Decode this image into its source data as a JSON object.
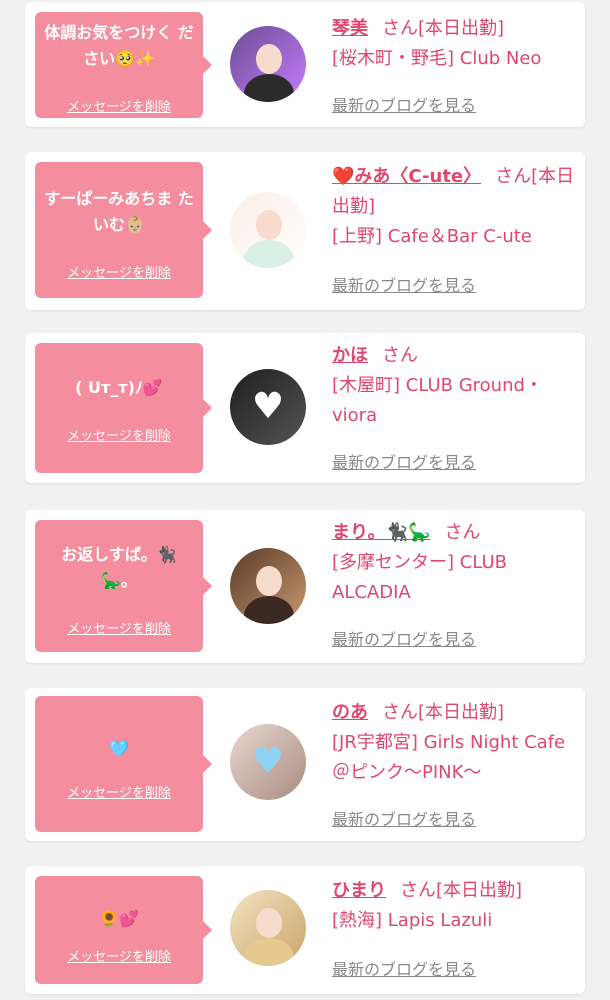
{
  "delete_label": "メッセージを削除",
  "blog_label": "最新のブログを見る",
  "cards": [
    {
      "msg": "体調お気をつけく ださい🥺✨",
      "name": "琴美",
      "san": "さん[本日出勤]",
      "store": "[桜木町・野毛] Club Neo"
    },
    {
      "msg": "すーぱーみあちま たいむ👶🏼",
      "name": "❤️みあ〈C-ute〉",
      "san": "さん[本日出勤]",
      "store": "[上野] Cafe＆Bar C-ute"
    },
    {
      "msg": "( Uт_т)ﾉ💕",
      "name": "かほ",
      "san": "さん",
      "store": "[木屋町] CLUB Ground・viora"
    },
    {
      "msg": "お返しすぱ。🐈‍⬛ 🦕。",
      "name": "まり。🐈‍⬛🦕",
      "san": "さん",
      "store": "[多摩センター] CLUB ALCADIA"
    },
    {
      "msg": "🩵",
      "name": "のあ",
      "san": "さん[本日出勤]",
      "store": "[JR宇都宮] Girls Night Cafe ＠ピンク〜PINK〜"
    },
    {
      "msg": "🌻💕",
      "name": "ひまり",
      "san": "さん[本日出勤]",
      "store": "[熱海] Lapis Lazuli"
    }
  ],
  "colors": {
    "bubble": "#f48d9d",
    "accent": "#e0476e",
    "background": "#f1f1f1"
  }
}
